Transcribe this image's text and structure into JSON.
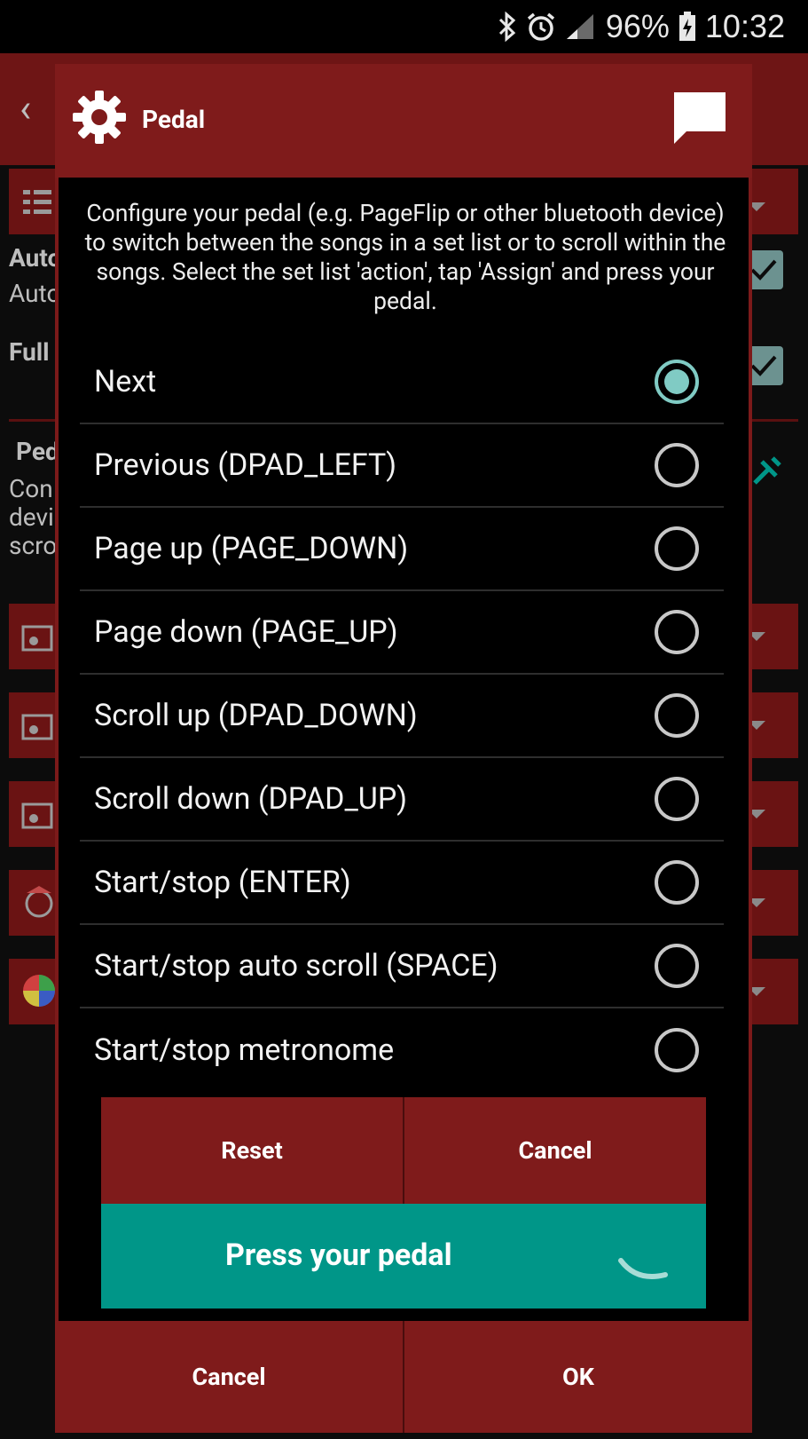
{
  "status_bar": {
    "battery_percent": "96%",
    "time": "10:32",
    "icons": [
      "bluetooth-icon",
      "alarm-icon",
      "signal-icon",
      "battery-charging-icon"
    ]
  },
  "background": {
    "row_labels": [
      "Auto",
      "Auto",
      "Full",
      "Ped",
      "Con",
      "devi",
      "scro"
    ]
  },
  "dialog": {
    "title": "Pedal",
    "description": "Configure your pedal (e.g. PageFlip or other bluetooth device) to switch between the songs in a set list or to scroll within the songs. Select the set list 'action', tap 'Assign' and press your pedal.",
    "options": [
      {
        "label": "Next",
        "selected": true
      },
      {
        "label": "Previous (DPAD_LEFT)",
        "selected": false
      },
      {
        "label": "Page up (PAGE_DOWN)",
        "selected": false
      },
      {
        "label": "Page down (PAGE_UP)",
        "selected": false
      },
      {
        "label": "Scroll up (DPAD_DOWN)",
        "selected": false
      },
      {
        "label": "Scroll down (DPAD_UP)",
        "selected": false
      },
      {
        "label": "Start/stop (ENTER)",
        "selected": false
      },
      {
        "label": "Start/stop auto scroll (SPACE)",
        "selected": false
      },
      {
        "label": "Start/stop metronome",
        "selected": false
      }
    ],
    "reset_label": "Reset",
    "inner_cancel_label": "Cancel",
    "press_label": "Press your pedal",
    "footer_cancel_label": "Cancel",
    "footer_ok_label": "OK"
  },
  "colors": {
    "dialog_red": "#7f1b1b",
    "accent_teal": "#009688",
    "radio_selected": "#80cbc4"
  }
}
